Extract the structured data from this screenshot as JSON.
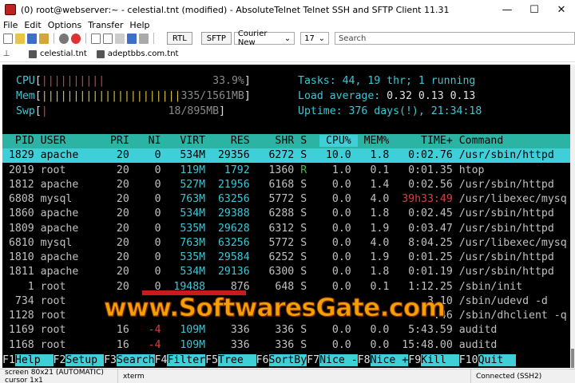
{
  "window": {
    "title": "(0) root@webserver:~ - celestial.tnt (modified) - AbsoluteTelnet Telnet SSH and SFTP Client 11.31",
    "minimize": "—",
    "maximize": "☐",
    "close": "✕"
  },
  "menu": [
    "File",
    "Edit",
    "Options",
    "Transfer",
    "Help"
  ],
  "toolbar": {
    "rtl_label": "RTL",
    "sftp_label": "SFTP",
    "font_value": "Courier New",
    "size_value": "17",
    "search_placeholder": "Search"
  },
  "tabs": [
    {
      "label": "celestial.tnt"
    },
    {
      "label": "adeptbbs.com.tnt"
    }
  ],
  "htop": {
    "meters_left": [
      {
        "label": "CPU",
        "bars": "||||||||||",
        "value": "33.9%"
      },
      {
        "label": "Mem",
        "bars": "||||||||||||||||||||||",
        "value": "335/1561MB"
      },
      {
        "label": "Swp",
        "bars": "|",
        "value": "18/895MB"
      }
    ],
    "tasks_label": "Tasks:",
    "tasks_value": "44, 19 thr; 1 running",
    "load_label": "Load average:",
    "load_values": [
      "0.32",
      "0.13",
      "0.13"
    ],
    "uptime_label": "Uptime:",
    "uptime_value": "376 days(!), 21:34:18",
    "columns": [
      "PID",
      "USER",
      "PRI",
      "NI",
      "VIRT",
      "RES",
      "SHR",
      "S",
      "CPU%",
      "MEM%",
      "TIME+",
      "Command"
    ],
    "processes": [
      {
        "pid": "1829",
        "user": "apache",
        "pri": "20",
        "ni": "0",
        "virt": "534M",
        "res": "29356",
        "shr": "6272",
        "s": "S",
        "cpu": "10.0",
        "mem": "1.8",
        "time": "0:02.76",
        "cmd": "/usr/sbin/httpd"
      },
      {
        "pid": "2019",
        "user": "root",
        "pri": "20",
        "ni": "0",
        "virt": "119M",
        "res": "1792",
        "shr": "1360",
        "s": "R",
        "cpu": "1.0",
        "mem": "0.1",
        "time": "0:01.35",
        "cmd": "htop"
      },
      {
        "pid": "1812",
        "user": "apache",
        "pri": "20",
        "ni": "0",
        "virt": "527M",
        "res": "21956",
        "shr": "6168",
        "s": "S",
        "cpu": "0.0",
        "mem": "1.4",
        "time": "0:02.56",
        "cmd": "/usr/sbin/httpd"
      },
      {
        "pid": "6808",
        "user": "mysql",
        "pri": "20",
        "ni": "0",
        "virt": "763M",
        "res": "63256",
        "shr": "5772",
        "s": "S",
        "cpu": "0.0",
        "mem": "4.0",
        "time": "39h33:49",
        "cmd": "/usr/libexec/mysq"
      },
      {
        "pid": "1860",
        "user": "apache",
        "pri": "20",
        "ni": "0",
        "virt": "534M",
        "res": "29388",
        "shr": "6288",
        "s": "S",
        "cpu": "0.0",
        "mem": "1.8",
        "time": "0:02.45",
        "cmd": "/usr/sbin/httpd"
      },
      {
        "pid": "1809",
        "user": "apache",
        "pri": "20",
        "ni": "0",
        "virt": "535M",
        "res": "29628",
        "shr": "6312",
        "s": "S",
        "cpu": "0.0",
        "mem": "1.9",
        "time": "0:03.47",
        "cmd": "/usr/sbin/httpd"
      },
      {
        "pid": "6810",
        "user": "mysql",
        "pri": "20",
        "ni": "0",
        "virt": "763M",
        "res": "63256",
        "shr": "5772",
        "s": "S",
        "cpu": "0.0",
        "mem": "4.0",
        "time": "8:04.25",
        "cmd": "/usr/libexec/mysq"
      },
      {
        "pid": "1810",
        "user": "apache",
        "pri": "20",
        "ni": "0",
        "virt": "535M",
        "res": "29584",
        "shr": "6252",
        "s": "S",
        "cpu": "0.0",
        "mem": "1.9",
        "time": "0:01.25",
        "cmd": "/usr/sbin/httpd"
      },
      {
        "pid": "1811",
        "user": "apache",
        "pri": "20",
        "ni": "0",
        "virt": "534M",
        "res": "29136",
        "shr": "6300",
        "s": "S",
        "cpu": "0.0",
        "mem": "1.8",
        "time": "0:01.19",
        "cmd": "/usr/sbin/httpd"
      },
      {
        "pid": "1",
        "user": "root",
        "pri": "20",
        "ni": "0",
        "virt": "19488",
        "res": "876",
        "shr": "648",
        "s": "S",
        "cpu": "0.0",
        "mem": "0.1",
        "time": "1:12.25",
        "cmd": "/sbin/init"
      },
      {
        "pid": "734",
        "user": "root",
        "pri": "",
        "ni": "",
        "virt": "",
        "res": "",
        "shr": "",
        "s": "",
        "cpu": "",
        "mem": "",
        "time": "3.10",
        "cmd": "/sbin/udevd -d"
      },
      {
        "pid": "1128",
        "user": "root",
        "pri": "",
        "ni": "",
        "virt": "",
        "res": "",
        "shr": "",
        "s": "",
        "cpu": "",
        "mem": "",
        "time": ".46",
        "cmd": "/sbin/dhclient -q"
      },
      {
        "pid": "1169",
        "user": "root",
        "pri": "16",
        "ni": "-4",
        "virt": "109M",
        "res": "336",
        "shr": "336",
        "s": "S",
        "cpu": "0.0",
        "mem": "0.0",
        "time": "5:43.59",
        "cmd": "auditd"
      },
      {
        "pid": "1168",
        "user": "root",
        "pri": "16",
        "ni": "-4",
        "virt": "109M",
        "res": "336",
        "shr": "336",
        "s": "S",
        "cpu": "0.0",
        "mem": "0.0",
        "time": "15:48.00",
        "cmd": "auditd"
      }
    ],
    "fkeys": [
      {
        "num": "F1",
        "label": "Help"
      },
      {
        "num": "F2",
        "label": "Setup"
      },
      {
        "num": "F3",
        "label": "Search"
      },
      {
        "num": "F4",
        "label": "Filter"
      },
      {
        "num": "F5",
        "label": "Tree"
      },
      {
        "num": "F6",
        "label": "SortBy"
      },
      {
        "num": "F7",
        "label": "Nice -"
      },
      {
        "num": "F8",
        "label": "Nice +"
      },
      {
        "num": "F9",
        "label": "Kill"
      },
      {
        "num": "F10",
        "label": "Quit"
      }
    ]
  },
  "status": {
    "screen": "screen 80x21 (AUTOMATIC) cursor 1x1",
    "term": "xterm",
    "connection": "Connected (SSH2)"
  },
  "watermark": "www.SoftwaresGate.com",
  "colors": {
    "terminal_bg": "#000000",
    "header_bar": "#2bb3a3",
    "selected_row": "#3fcfd8",
    "meter_text": "#3dc6d6",
    "watermark": "#f4a000"
  }
}
